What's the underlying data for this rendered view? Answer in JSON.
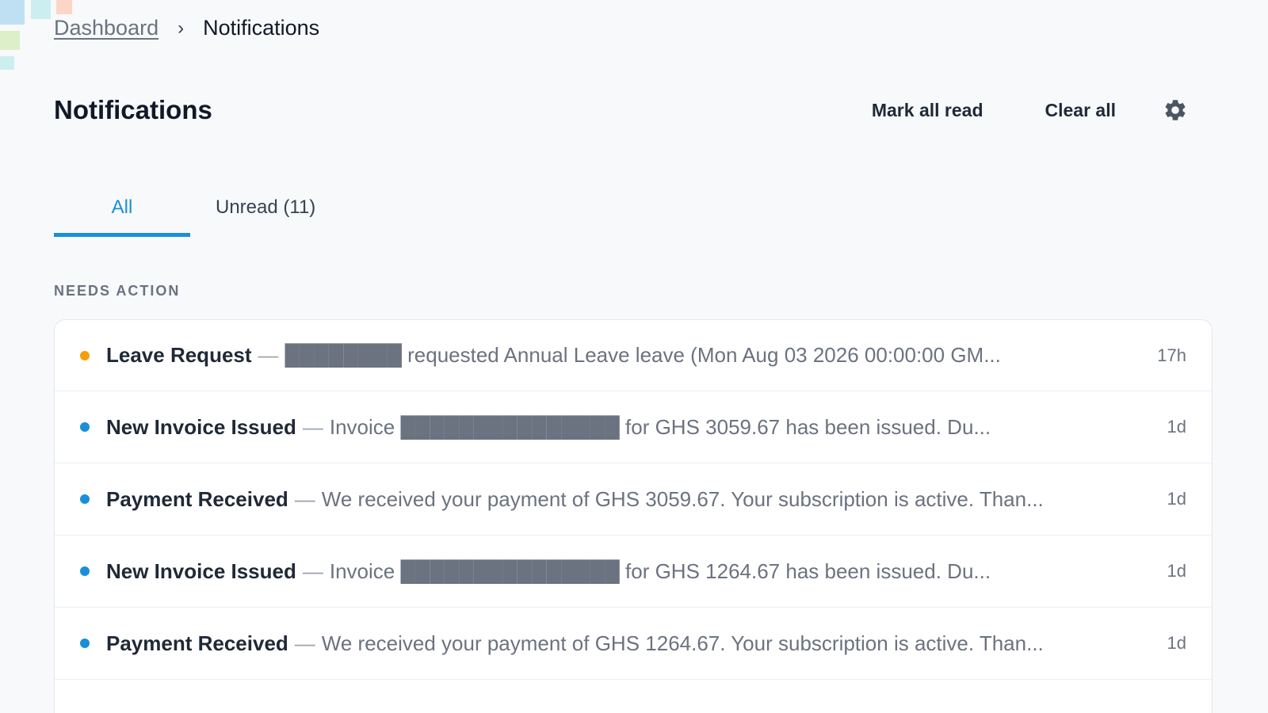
{
  "breadcrumb": {
    "parent": "Dashboard",
    "separator": "›",
    "current": "Notifications"
  },
  "header": {
    "title": "Notifications",
    "mark_all_read": "Mark all read",
    "clear_all": "Clear all",
    "settings_icon": "gear-icon"
  },
  "tabs": [
    {
      "label": "All",
      "active": true
    },
    {
      "label": "Unread (11)",
      "active": false
    }
  ],
  "section": {
    "label": "NEEDS ACTION"
  },
  "colors": {
    "accent": "#1a8fd8",
    "dot_warning": "#f59e0b",
    "dot_info": "#1a8fd8"
  },
  "notifications": [
    {
      "title": "Leave Request",
      "separator": "—",
      "message": "████████ requested Annual Leave leave (Mon Aug 03 2026 00:00:00 GM...",
      "time": "17h",
      "status": "warning"
    },
    {
      "title": "New Invoice Issued",
      "separator": "—",
      "message": "Invoice ███████████████ for GHS 3059.67 has been issued. Du...",
      "time": "1d",
      "status": "info"
    },
    {
      "title": "Payment Received",
      "separator": "—",
      "message": "We received your payment of GHS 3059.67. Your subscription is active. Than...",
      "time": "1d",
      "status": "info"
    },
    {
      "title": "New Invoice Issued",
      "separator": "—",
      "message": "Invoice ███████████████ for GHS 1264.67 has been issued. Du...",
      "time": "1d",
      "status": "info"
    },
    {
      "title": "Payment Received",
      "separator": "—",
      "message": "We received your payment of GHS 1264.67. Your subscription is active. Than...",
      "time": "1d",
      "status": "info"
    }
  ]
}
